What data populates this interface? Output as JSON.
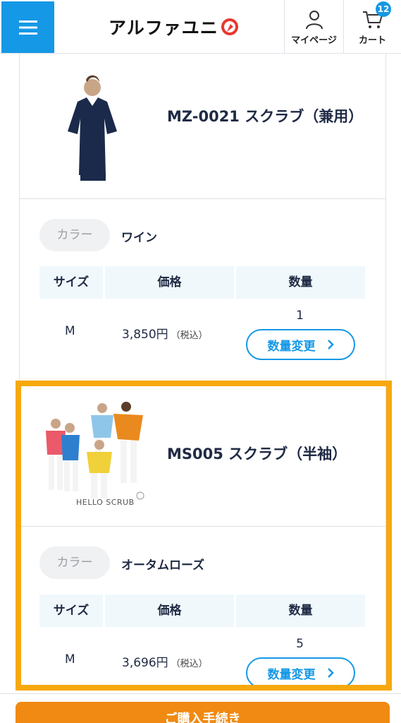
{
  "header": {
    "logo_text": "アルファユニ",
    "mypage_label": "マイページ",
    "cart_label": "カート",
    "cart_count": "12",
    "brand_color": "#1598e6"
  },
  "items": [
    {
      "name": "MZ-0021 スクラブ（兼用）",
      "color_label": "カラー",
      "color_value": "ワイン",
      "headers": {
        "size": "サイズ",
        "price": "価格",
        "qty": "数量"
      },
      "size": "M",
      "price": "3,850円",
      "tax": "（税込）",
      "qty": "1",
      "qty_button": "数量変更"
    },
    {
      "name": "MS005 スクラブ（半袖）",
      "image_caption": "HELLO SCRUB",
      "color_label": "カラー",
      "color_value": "オータムローズ",
      "headers": {
        "size": "サイズ",
        "price": "価格",
        "qty": "数量"
      },
      "size": "M",
      "price": "3,696円",
      "tax": "（税込）",
      "qty": "5",
      "qty_button": "数量変更"
    }
  ],
  "checkout_button": "ご購入手続き"
}
